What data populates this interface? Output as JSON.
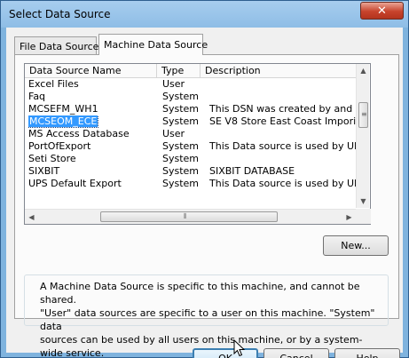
{
  "window": {
    "title": "Select Data Source",
    "close_glyph": "✕"
  },
  "tabs": [
    {
      "label": "File Data Source",
      "selected": false
    },
    {
      "label": "Machine Data Source",
      "selected": true
    }
  ],
  "list": {
    "columns": [
      "Data Source Name",
      "Type",
      "Description"
    ],
    "rows": [
      {
        "name": "Excel Files",
        "type": "User",
        "description": ""
      },
      {
        "name": "Faq",
        "type": "System",
        "description": ""
      },
      {
        "name": "MCSEFM_WH1",
        "type": "System",
        "description": "This DSN was created by and is for t"
      },
      {
        "name": "MCSEOM_ECE",
        "type": "System",
        "description": "SE V8 Store East Coast Imporium",
        "selected": true
      },
      {
        "name": "MS Access Database",
        "type": "User",
        "description": ""
      },
      {
        "name": "PortOfExport",
        "type": "System",
        "description": "This Data source is used by UPS Wo"
      },
      {
        "name": "Seti Store",
        "type": "System",
        "description": ""
      },
      {
        "name": "SIXBIT",
        "type": "System",
        "description": "SIXBIT DATABASE"
      },
      {
        "name": "UPS Default Export",
        "type": "System",
        "description": "This Data source is used by UPS Wo"
      }
    ]
  },
  "buttons": {
    "new": "New...",
    "ok": "OK",
    "cancel": "Cancel",
    "help": "Help"
  },
  "info_text": "A Machine Data Source is specific to this machine, and cannot be shared.\n\"User\" data sources are specific to a user on this machine.  \"System\" data\nsources can be used by all users on this machine, or by a system-wide service.",
  "colors": {
    "title_bar": "#8ebde6",
    "selection": "#3399ff",
    "close_button": "#c7432c"
  }
}
